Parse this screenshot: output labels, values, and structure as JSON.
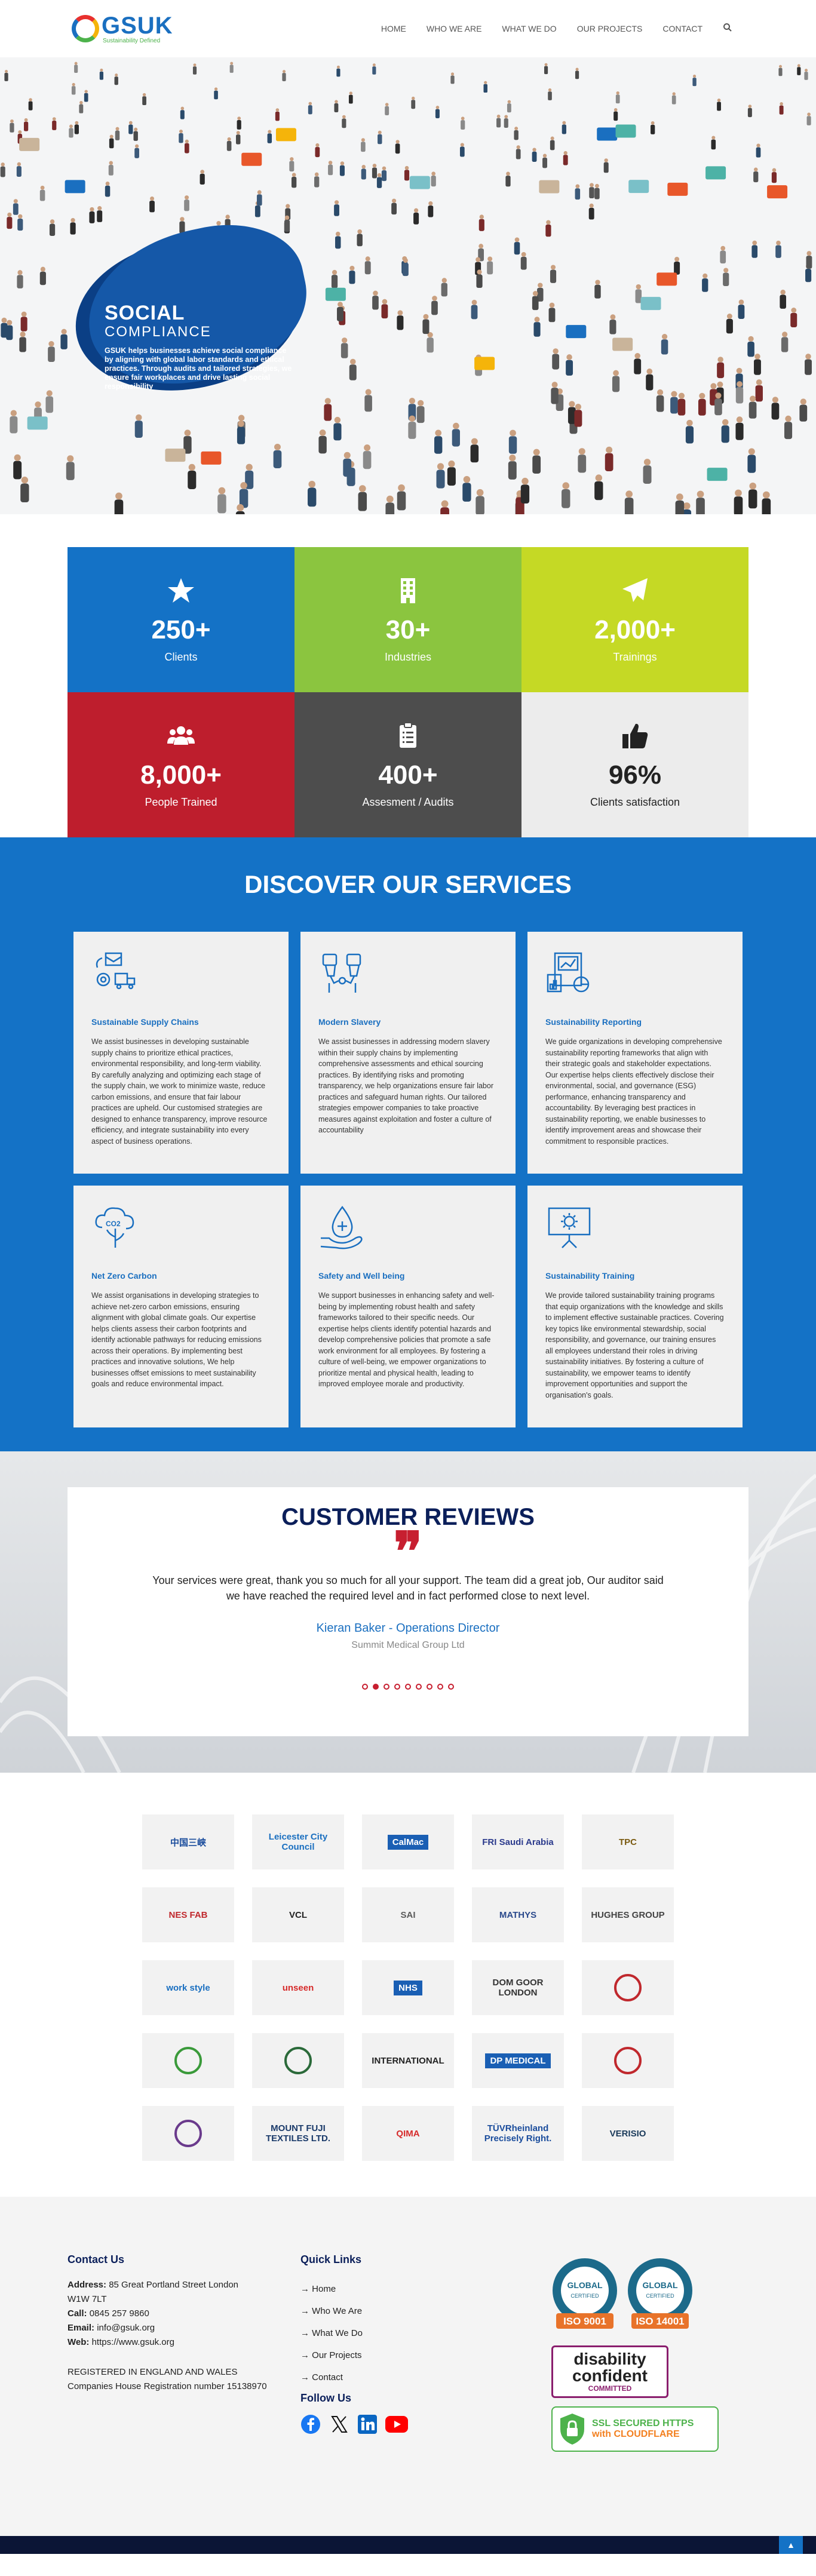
{
  "header": {
    "logo_name": "GSUK",
    "logo_tagline": "Sustainability Defined",
    "nav": [
      "HOME",
      "WHO WE ARE",
      "WHAT WE DO",
      "OUR PROJECTS",
      "CONTACT"
    ]
  },
  "hero": {
    "title": "SOCIAL",
    "subtitle": "COMPLIANCE",
    "description": "GSUK helps businesses achieve social compliance by aligning with global labor standards and ethical practices. Through audits and tailored strategies, we ensure fair workplaces and drive lasting social responsibility"
  },
  "stats": [
    {
      "value": "250+",
      "label": "Clients",
      "color": "#1472c6",
      "icon": "star-icon"
    },
    {
      "value": "30+",
      "label": "Industries",
      "color": "#8bc53f",
      "icon": "building-icon"
    },
    {
      "value": "2,000+",
      "label": "Trainings",
      "color": "#c5d925",
      "icon": "paper-plane-icon"
    },
    {
      "value": "8,000+",
      "label": "People Trained",
      "color": "#be1e2d",
      "icon": "users-icon"
    },
    {
      "value": "400+",
      "label": "Assesment / Audits",
      "color": "#4d4d4d",
      "icon": "clipboard-icon"
    },
    {
      "value": "96%",
      "label": "Clients satisfaction",
      "color": "#ececec",
      "icon": "thumbs-up-icon"
    }
  ],
  "services": {
    "heading": "DISCOVER OUR SERVICES",
    "items": [
      {
        "title": "Sustainable Supply Chains",
        "text": "We assist businesses in developing sustainable supply chains to prioritize ethical practices, environmental responsibility, and long-term viability. By carefully analyzing and optimizing each stage of the supply chain, we work to minimize waste, reduce carbon emissions, and ensure that fair labour practices are upheld. Our customised strategies are designed to enhance transparency, improve resource efficiency, and integrate sustainability into every aspect of business operations."
      },
      {
        "title": "Modern Slavery",
        "text": "We assist businesses in addressing modern slavery within their supply chains by implementing comprehensive assessments and ethical sourcing practices. By identifying risks and promoting transparency, we help organizations ensure fair labor practices and safeguard human rights. Our tailored strategies empower companies to take proactive measures against exploitation and foster a culture of accountability"
      },
      {
        "title": "Sustainability Reporting",
        "text": "We guide organizations in developing comprehensive sustainability reporting frameworks that align with their strategic goals and stakeholder expectations. Our expertise helps clients effectively disclose their environmental, social, and governance (ESG) performance, enhancing transparency and accountability. By leveraging best practices in sustainability reporting, we enable businesses to identify improvement areas and showcase their commitment to responsible practices."
      },
      {
        "title": "Net Zero Carbon",
        "text": "We assist organisations in developing strategies to achieve net-zero carbon emissions, ensuring alignment with global climate goals. Our expertise helps clients assess their carbon footprints and identify actionable pathways for reducing emissions across their operations. By implementing best practices and innovative solutions, We help businesses offset emissions to meet sustainability goals and reduce environmental impact."
      },
      {
        "title": "Safety and Well being",
        "text": "We support businesses in enhancing safety and well-being by implementing robust health and safety frameworks tailored to their specific needs. Our expertise helps clients identify potential hazards and develop comprehensive policies that promote a safe work environment for all employees. By fostering a culture of well-being, we empower organizations to prioritize mental and physical health, leading to improved employee morale and productivity."
      },
      {
        "title": "Sustainability Training",
        "text": "We provide tailored sustainability training programs that equip organizations with the knowledge and skills to implement effective sustainable practices. Covering key topics like environmental stewardship, social responsibility, and governance, our training ensures all employees understand their roles in driving sustainability initiatives. By fostering a culture of sustainability, we empower teams to identify improvement opportunities and support the organisation's goals."
      }
    ]
  },
  "reviews": {
    "heading": "CUSTOMER REVIEWS",
    "text": "Your services were great, thank you so much for all your support. The team did a great job, Our auditor said we have reached the required level and in fact performed close to next level.",
    "name": "Kieran Baker - Operations Director",
    "company": "Summit Medical Group Ltd",
    "dot_count": 9,
    "active_dot": 1
  },
  "clients": [
    {
      "name": "中国三峡",
      "color": "#1a4c9c"
    },
    {
      "name": "Leicester City Council",
      "color": "#1a6fc0"
    },
    {
      "name": "CalMac",
      "color": "#ffffff"
    },
    {
      "name": "FRI Saudi Arabia",
      "color": "#2b3a8c"
    },
    {
      "name": "TPC",
      "color": "#7a5a10"
    },
    {
      "name": "NES FAB",
      "color": "#c0282d"
    },
    {
      "name": "VCL",
      "color": "#222222"
    },
    {
      "name": "SAI",
      "color": "#5a5a5a"
    },
    {
      "name": "MATHYS",
      "color": "#2b4a8c"
    },
    {
      "name": "HUGHES GROUP",
      "color": "#444444"
    },
    {
      "name": "work style",
      "color": "#1a6fc0"
    },
    {
      "name": "unseen",
      "color": "#d62a2a"
    },
    {
      "name": "NHS",
      "color": "#ffffff"
    },
    {
      "name": "DOM GOOR LONDON",
      "color": "#333333"
    },
    {
      "name": "",
      "color": "#c0282d"
    },
    {
      "name": "",
      "color": "#3a9a3a"
    },
    {
      "name": "",
      "color": "#2b6a3a"
    },
    {
      "name": "INTERNATIONAL",
      "color": "#222222"
    },
    {
      "name": "DP MEDICAL",
      "color": "#ffffff"
    },
    {
      "name": "",
      "color": "#c0282d"
    },
    {
      "name": "",
      "color": "#6a3a8c"
    },
    {
      "name": "MOUNT FUJI TEXTILES LTD.",
      "color": "#1a3a6a"
    },
    {
      "name": "QIMA",
      "color": "#d62a2a"
    },
    {
      "name": "TÜVRheinland Precisely Right.",
      "color": "#1a4c9c"
    },
    {
      "name": "VERISIO",
      "color": "#1a3a5a"
    }
  ],
  "footer": {
    "contact_heading": "Contact Us",
    "address_label": "Address:",
    "address_line1": "85 Great Portland Street London",
    "address_line2": "W1W 7LT",
    "call_label": "Call:",
    "call": "0845 257 9860",
    "email_label": "Email:",
    "email": "info@gsuk.org",
    "web_label": "Web:",
    "web": "https://www.gsuk.org",
    "reg1": "REGISTERED IN ENGLAND AND WALES",
    "reg2": "Companies House Registration number 15138970",
    "quick_heading": "Quick Links",
    "quick_links": [
      "Home",
      "Who We Are",
      "What We Do",
      "Our Projects",
      "Contact"
    ],
    "follow_heading": "Follow Us",
    "iso1": "ISO 9001",
    "iso2": "ISO 14001",
    "iso_certified": "CERTIFIED",
    "iso_global": "GLOBAL",
    "iso_top": "QUALITY MANAGEMENT SYSTEM",
    "disability1": "disability",
    "disability2": "confident",
    "disability3": "COMMITTED",
    "ssl1": "SSL SECURED HTTPS",
    "ssl2": "with CLOUDFLARE"
  }
}
